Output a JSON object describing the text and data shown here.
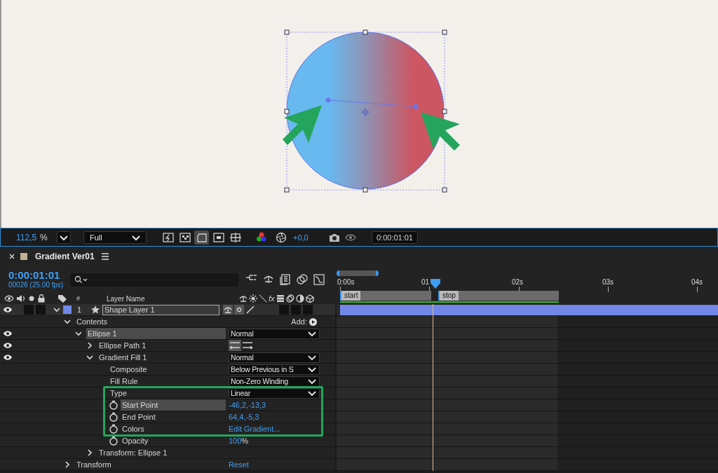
{
  "viewer_toolbar": {
    "zoom": "112,5",
    "zoom_unit": "%",
    "resolution": "Full",
    "exposure": "+0,0",
    "time": "0:00:01:01",
    "toggles": [
      {
        "kind": "fast-preview",
        "on": false
      },
      {
        "kind": "transparency-grid",
        "on": false
      },
      {
        "kind": "region",
        "on": true
      },
      {
        "kind": "mask",
        "on": false
      },
      {
        "kind": "guides",
        "on": false
      }
    ]
  },
  "panel": {
    "title": "Gradient Ver01",
    "timecode": "0:00:01:01",
    "frame_info": "00026 (25.00 fps)"
  },
  "columns": {
    "number": "#",
    "layer_name": "Layer Name",
    "fx": "fx"
  },
  "ruler": [
    "0:00s",
    "01",
    "02s",
    "03s",
    "04s"
  ],
  "markers": [
    "start",
    "stop"
  ],
  "layers": [
    {
      "number": "1",
      "name": "Shape Layer 1",
      "color": "#7188e8",
      "visible": true,
      "solo": false,
      "locked": false,
      "switches": [
        {
          "on": false
        },
        {
          "on": false
        },
        {
          "on": false
        }
      ],
      "expanded": true,
      "children": [
        {
          "name": "Contents",
          "expanded": true,
          "selected": false,
          "add_label": "Add:",
          "children": [
            {
              "name": "Ellipse 1",
              "visible": true,
              "expanded": true,
              "selected": true,
              "value": {
                "kind": "dropdown",
                "text": "Normal"
              },
              "children": [
                {
                  "name": "Ellipse Path 1",
                  "visible": true,
                  "expanded": false,
                  "selected": false,
                  "value": {
                    "kind": "direction"
                  }
                },
                {
                  "name": "Gradient Fill 1",
                  "visible": true,
                  "expanded": true,
                  "selected": false,
                  "value": {
                    "kind": "dropdown",
                    "text": "Normal"
                  },
                  "children": [
                    {
                      "name": "Composite",
                      "selected": false,
                      "value": {
                        "kind": "dropdown",
                        "text": "Below Previous in S"
                      }
                    },
                    {
                      "name": "Fill Rule",
                      "selected": false,
                      "value": {
                        "kind": "dropdown",
                        "text": "Non-Zero Winding"
                      }
                    },
                    {
                      "name": "Type",
                      "selected": false,
                      "value": {
                        "kind": "dropdown",
                        "text": "Linear"
                      }
                    },
                    {
                      "name": "Start Point",
                      "stopwatch": true,
                      "selected": true,
                      "value": {
                        "kind": "number",
                        "text": "-46,2,-13,3"
                      }
                    },
                    {
                      "name": "End Point",
                      "stopwatch": true,
                      "selected": false,
                      "value": {
                        "kind": "number",
                        "text": "64,4,-5,3"
                      }
                    },
                    {
                      "name": "Colors",
                      "stopwatch": true,
                      "selected": false,
                      "value": {
                        "kind": "link",
                        "text": "Edit Gradient..."
                      }
                    },
                    {
                      "name": "Opacity",
                      "stopwatch": true,
                      "selected": false,
                      "value": {
                        "kind": "number",
                        "text": "100",
                        "unit": "%"
                      }
                    }
                  ]
                },
                {
                  "name": "Transform: Ellipse 1",
                  "expanded": false,
                  "selected": false
                }
              ]
            }
          ]
        },
        {
          "name": "Transform",
          "expanded": false,
          "selected": false,
          "value": {
            "kind": "link",
            "text": "Reset"
          }
        }
      ]
    }
  ]
}
